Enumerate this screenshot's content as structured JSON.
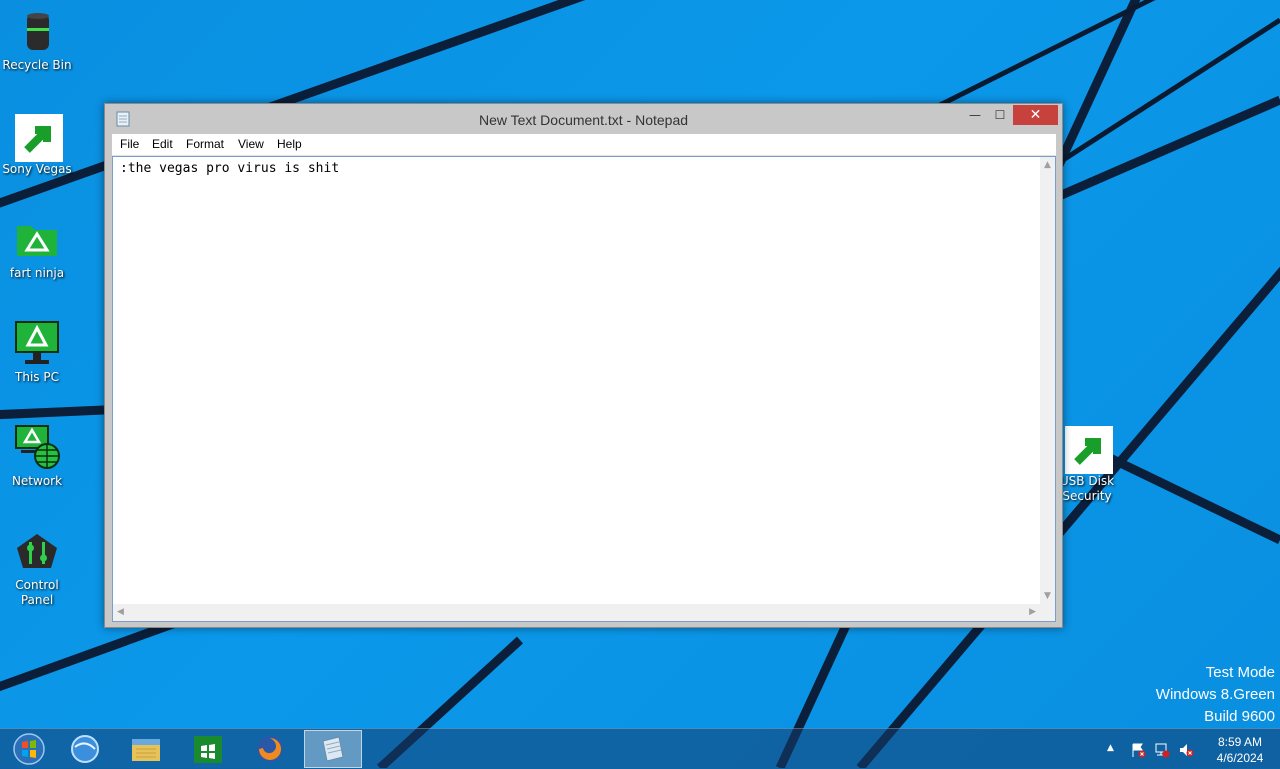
{
  "desktop": {
    "icons": [
      {
        "label": "Recycle Bin"
      },
      {
        "label": "Sony Vegas"
      },
      {
        "label": "fart ninja"
      },
      {
        "label": "This PC"
      },
      {
        "label": "Network"
      },
      {
        "label": "Control Panel"
      },
      {
        "label": "USB Disk Security"
      }
    ]
  },
  "notepad": {
    "title": "New Text Document.txt - Notepad",
    "close_glyph": "✕",
    "minimize_glyph": "—",
    "maximize_glyph": "☐",
    "menu": [
      "File",
      "Edit",
      "Format",
      "View",
      "Help"
    ],
    "content": ":the vegas pro virus is shit"
  },
  "watermark": {
    "line1": "Test Mode",
    "line2": "Windows 8.Green",
    "line3": "Build 9600"
  },
  "taskbar": {
    "pinned": [
      "start-orb-icon",
      "internet-explorer-icon",
      "file-explorer-icon",
      "store-icon",
      "firefox-icon",
      "notepad-icon"
    ],
    "tray_arrow": "▲",
    "clock": {
      "time": "8:59 AM",
      "date": "4/6/2024"
    }
  },
  "colors": {
    "accent": "#0a8fe0",
    "close": "#c7423c",
    "green": "#22c33a"
  }
}
